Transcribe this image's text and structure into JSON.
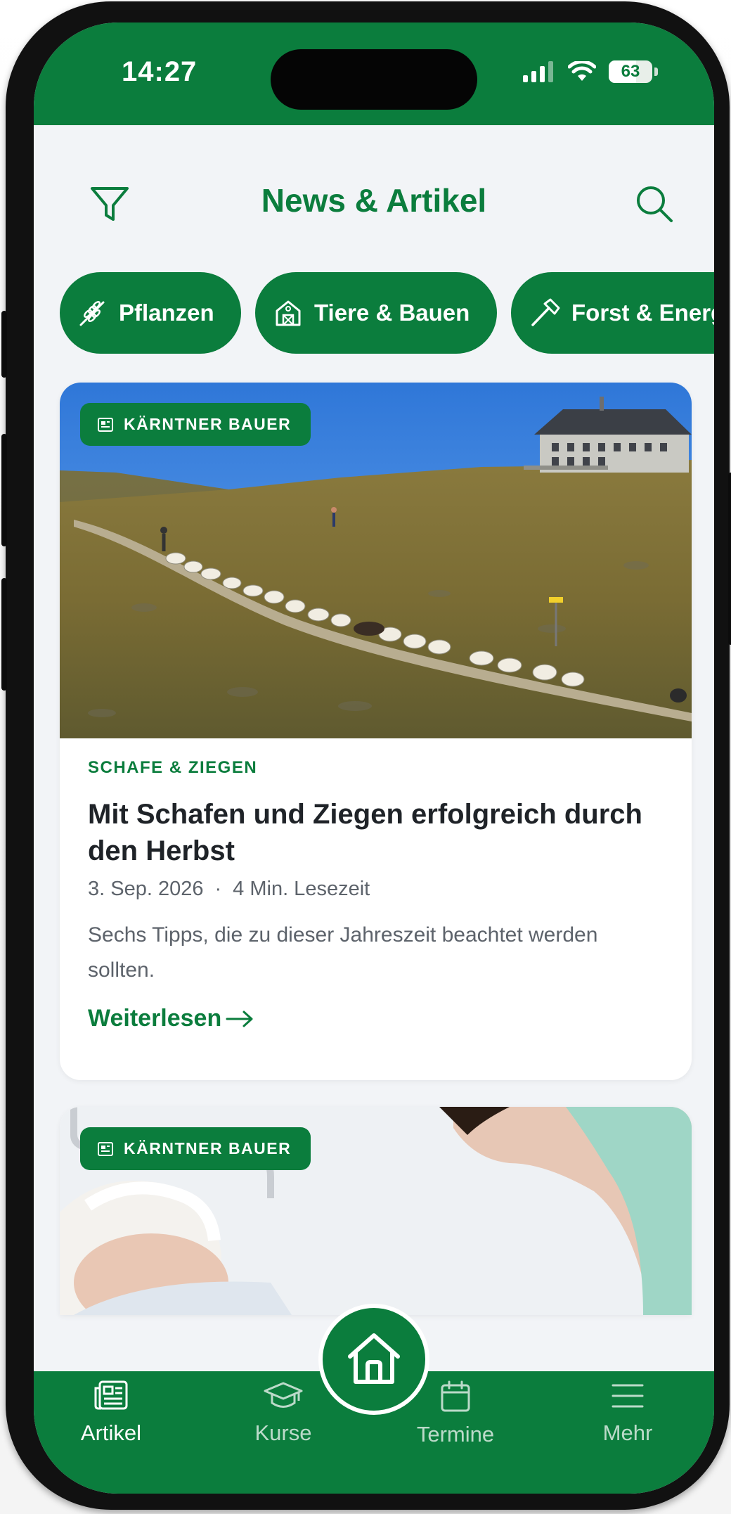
{
  "status_bar": {
    "time": "14:27",
    "battery_percent": 63,
    "battery_label": "63",
    "icons": [
      "signal-icon",
      "wifi-icon",
      "battery-icon"
    ]
  },
  "header": {
    "title": "News & Artikel",
    "left_icon": "filter-icon",
    "right_icon": "search-icon"
  },
  "chips": [
    {
      "label": "Pflanzen",
      "icon": "wheat-icon"
    },
    {
      "label": "Tiere & Bauen",
      "icon": "barn-icon"
    },
    {
      "label": "Forst & Energie",
      "icon": "axe-icon"
    }
  ],
  "articles": [
    {
      "source": "KÄRNTNER BAUER",
      "category": "SCHAFE & ZIEGEN",
      "title": "Mit Schafen und Ziegen erfolgreich durch den Herbst",
      "date": "3. Sep. 2026",
      "separator": "·",
      "read_time": "4 Min. Lesezeit",
      "excerpt": "Sechs Tipps, die zu dieser Jahreszeit beachtet werden sollten.",
      "read_more": "Weiterlesen"
    },
    {
      "source": "KÄRNTNER BAUER"
    }
  ],
  "nav": {
    "items": [
      {
        "label": "Artikel",
        "icon": "newspaper-icon",
        "active": true
      },
      {
        "label": "Kurse",
        "icon": "graduation-cap-icon",
        "active": false
      },
      {
        "label": "Termine",
        "icon": "calendar-icon",
        "active": false
      },
      {
        "label": "Mehr",
        "icon": "menu-icon",
        "active": false
      }
    ],
    "center_icon": "home-icon"
  },
  "colors": {
    "brand_green": "#0b7d3d",
    "background": "#f2f4f7",
    "text_dark": "#1f2328",
    "text_muted": "#5d636b"
  }
}
